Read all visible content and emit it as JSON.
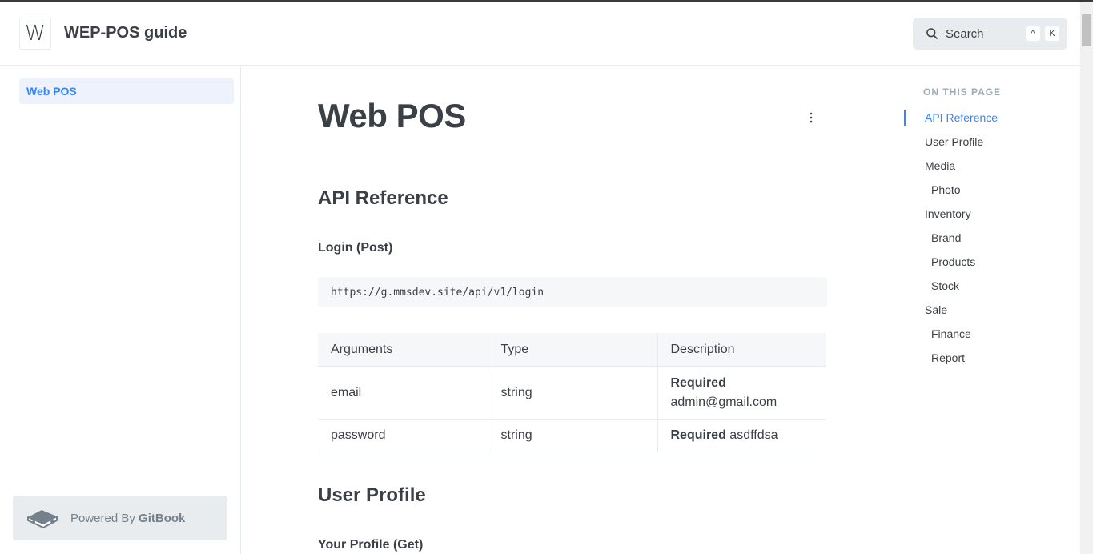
{
  "header": {
    "logo_letter": "W",
    "site_title": "WEP-POS guide",
    "search": {
      "label": "Search",
      "shortcut_mod": "^",
      "shortcut_key": "K"
    }
  },
  "sidebar": {
    "items": [
      {
        "label": "Web POS",
        "active": true
      }
    ],
    "powered_prefix": "Powered By ",
    "powered_brand": "GitBook"
  },
  "main": {
    "title": "Web POS",
    "sections": [
      {
        "heading": "API Reference",
        "subheading": "Login (Post)",
        "code": "https://g.mmsdev.site/api/v1/login"
      },
      {
        "heading": "User Profile",
        "subheading": "Your Profile (Get)"
      }
    ],
    "table": {
      "headers": [
        "Arguments",
        "Type",
        "Description"
      ],
      "rows": [
        {
          "argument": "email",
          "type": "string",
          "required": "Required",
          "value": "admin@gmail.com"
        },
        {
          "argument": "password",
          "type": "string",
          "required": "Required",
          "value": "asdffdsa"
        }
      ]
    }
  },
  "toc": {
    "heading": "ON THIS PAGE",
    "items": [
      {
        "label": "API Reference",
        "level": 1,
        "active": true
      },
      {
        "label": "User Profile",
        "level": 1
      },
      {
        "label": "Media",
        "level": 1
      },
      {
        "label": "Photo",
        "level": 2
      },
      {
        "label": "Inventory",
        "level": 1
      },
      {
        "label": "Brand",
        "level": 2
      },
      {
        "label": "Products",
        "level": 2
      },
      {
        "label": "Stock",
        "level": 2
      },
      {
        "label": "Sale",
        "level": 1
      },
      {
        "label": "Finance",
        "level": 2
      },
      {
        "label": "Report",
        "level": 2
      }
    ]
  },
  "colors": {
    "accent": "#3884ff",
    "text": "#3b4047",
    "muted": "#9daab6",
    "border": "#e6ecf1"
  }
}
